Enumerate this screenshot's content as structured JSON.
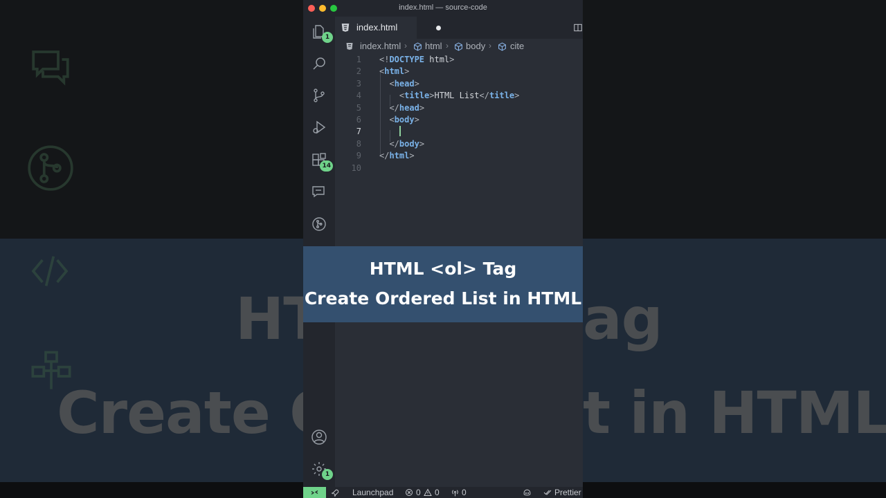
{
  "window": {
    "title": "index.html — source-code"
  },
  "traffic_lights": {
    "close": "#fe5f57",
    "minimize": "#febc2e",
    "maximize": "#28c840"
  },
  "colors": {
    "accent": "#6fd38a",
    "tag": "#7ab2e8",
    "overlay_bg": "#34506f"
  },
  "activity_bar": {
    "items": [
      {
        "name": "explorer",
        "icon": "files-icon",
        "badge": "1"
      },
      {
        "name": "search",
        "icon": "search-icon",
        "badge": ""
      },
      {
        "name": "source-control",
        "icon": "source-control-icon",
        "badge": ""
      },
      {
        "name": "run-debug",
        "icon": "run-debug-icon",
        "badge": ""
      },
      {
        "name": "extensions",
        "icon": "extensions-icon",
        "badge": "14"
      },
      {
        "name": "chat",
        "icon": "chat-icon",
        "badge": ""
      },
      {
        "name": "git-lens",
        "icon": "git-graph-icon",
        "badge": ""
      },
      {
        "name": "remote",
        "icon": "remote-icon",
        "badge": ""
      },
      {
        "name": "flow",
        "icon": "flow-icon",
        "badge": ""
      }
    ],
    "accounts_icon": "account-icon",
    "settings": {
      "icon": "gear-icon",
      "badge": "1"
    }
  },
  "tab": {
    "label": "index.html",
    "icon": "html5-icon",
    "dirty": true
  },
  "breadcrumb": {
    "file": "index.html",
    "items": [
      "html",
      "body",
      "cite"
    ]
  },
  "editor": {
    "active_line": 7,
    "lines": [
      {
        "n": "1",
        "parts": [
          [
            "p",
            "<!"
          ],
          [
            "t",
            "DOCTYPE"
          ],
          [
            "x",
            " html"
          ],
          [
            "p",
            ">"
          ]
        ]
      },
      {
        "n": "2",
        "parts": [
          [
            "p",
            "<"
          ],
          [
            "t",
            "html"
          ],
          [
            "p",
            ">"
          ]
        ]
      },
      {
        "n": "3",
        "parts": [
          [
            "x",
            "  "
          ],
          [
            "p",
            "<"
          ],
          [
            "t",
            "head"
          ],
          [
            "p",
            ">"
          ]
        ]
      },
      {
        "n": "4",
        "parts": [
          [
            "x",
            "    "
          ],
          [
            "p",
            "<"
          ],
          [
            "t",
            "title"
          ],
          [
            "p",
            ">"
          ],
          [
            "x",
            "HTML List"
          ],
          [
            "p",
            "</"
          ],
          [
            "t",
            "title"
          ],
          [
            "p",
            ">"
          ]
        ]
      },
      {
        "n": "5",
        "parts": [
          [
            "x",
            "  "
          ],
          [
            "p",
            "</"
          ],
          [
            "t",
            "head"
          ],
          [
            "p",
            ">"
          ]
        ]
      },
      {
        "n": "6",
        "parts": [
          [
            "x",
            "  "
          ],
          [
            "p",
            "<"
          ],
          [
            "t",
            "body"
          ],
          [
            "p",
            ">"
          ]
        ]
      },
      {
        "n": "7",
        "parts": []
      },
      {
        "n": "8",
        "parts": [
          [
            "x",
            "  "
          ],
          [
            "p",
            "</"
          ],
          [
            "t",
            "body"
          ],
          [
            "p",
            ">"
          ]
        ]
      },
      {
        "n": "9",
        "parts": [
          [
            "p",
            "</"
          ],
          [
            "t",
            "html"
          ],
          [
            "p",
            ">"
          ]
        ]
      },
      {
        "n": "10",
        "parts": []
      }
    ]
  },
  "overlay": {
    "line1": "HTML <ol> Tag",
    "line2": "Create Ordered List in HTML"
  },
  "background_text": {
    "line1_left": "HT",
    "line1_right": "ag",
    "line2_left": "Create Or",
    "line2_right": "t in HTML"
  },
  "status_bar": {
    "launchpad": "Launchpad",
    "errors": "0",
    "warnings": "0",
    "ports": "0",
    "prettier": "Prettier"
  }
}
